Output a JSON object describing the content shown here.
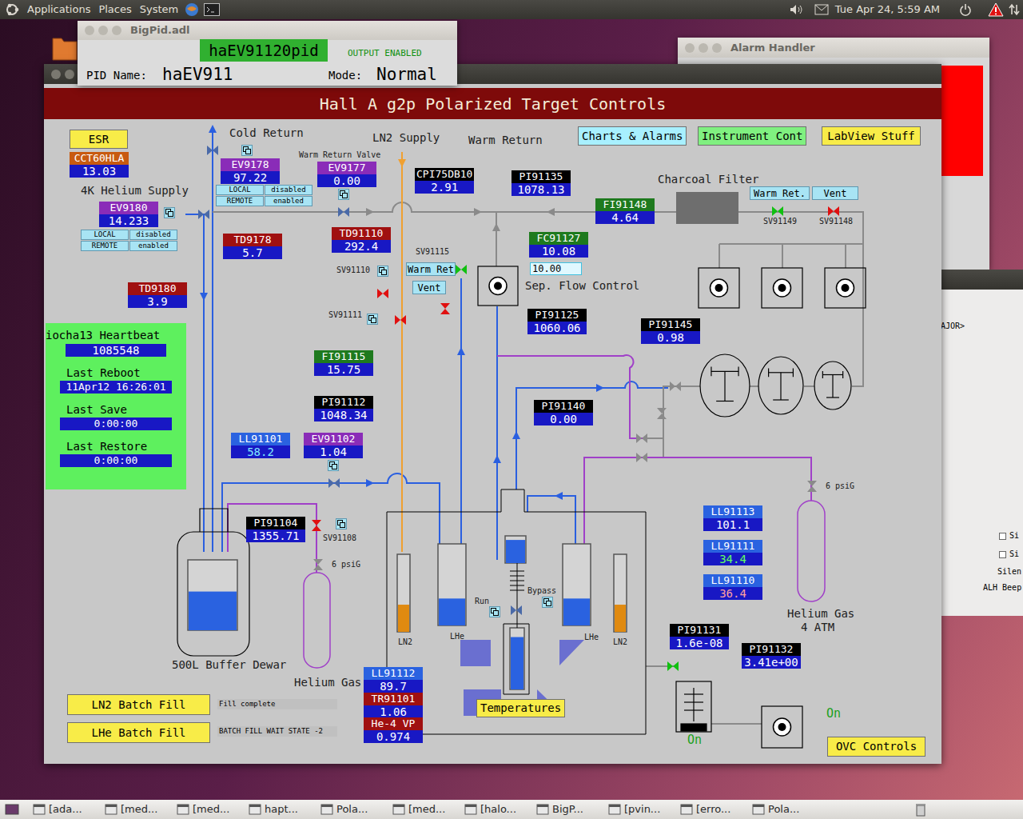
{
  "top_panel": {
    "menus": [
      "Applications",
      "Places",
      "System"
    ],
    "clock": "Tue Apr 24, 5:59 AM"
  },
  "bigpid": {
    "title": "BigPid.adl",
    "record": "haEV91120pid",
    "output": "OUTPUT ENABLED",
    "pid_name_label": "PID Name:",
    "pid_name": "haEV911",
    "mode_label": "Mode:",
    "mode": "Normal"
  },
  "alarm_handler": {
    "title": "Alarm Handler",
    "alarm_color": "#ff0000"
  },
  "side_window": {
    "prompt": "AJOR>",
    "checkboxes": [
      {
        "label": "Si",
        "checked": false
      },
      {
        "label": "Si",
        "checked": false
      }
    ],
    "labels": [
      "Silen",
      "ALH Beep"
    ]
  },
  "main": {
    "header": "Hall A g2p Polarized Target Controls",
    "buttons": [
      {
        "label": "ESR",
        "color": "#f8ec48"
      },
      {
        "label": "Charts & Alarms",
        "color": "#a8f0ff"
      },
      {
        "label": "Instrument Cont",
        "color": "#80f080"
      },
      {
        "label": "LabView Stuff",
        "color": "#f8ec48"
      },
      {
        "label": "LN2 Batch Fill",
        "color": "#f8ec48"
      },
      {
        "label": "LHe Batch Fill",
        "color": "#f8ec48"
      },
      {
        "label": "Temperatures",
        "color": "#f8ec48"
      },
      {
        "label": "OVC Controls",
        "color": "#f8ec48"
      }
    ],
    "small_buttons": [
      {
        "label": "LOCAL"
      },
      {
        "label": "disabled"
      },
      {
        "label": "REMOTE"
      },
      {
        "label": "enabled"
      },
      {
        "label": "LOCAL"
      },
      {
        "label": "disabled"
      },
      {
        "label": "REMOTE"
      },
      {
        "label": "enabled"
      },
      {
        "label": "Warm Ret"
      },
      {
        "label": "Vent"
      },
      {
        "label": "Warm Ret."
      },
      {
        "label": "Vent"
      }
    ],
    "batch_status": [
      "Fill complete",
      "BATCH FILL WAIT STATE -2"
    ],
    "setpoint": "10.00",
    "readouts": [
      {
        "label": "CCT60HLA",
        "value": "13.03",
        "color": "#c85a10",
        "valueColor": "#ffffff"
      },
      {
        "label": "EV9178",
        "value": "97.22",
        "color": "#8a2cb8",
        "valueColor": "#ffffff"
      },
      {
        "label": "EV9177",
        "value": "0.00",
        "color": "#8a2cb8",
        "valueColor": "#ffffff"
      },
      {
        "label": "EV9180",
        "value": "14.233",
        "color": "#8a2cb8",
        "valueColor": "#ffffff"
      },
      {
        "label": "TD9178",
        "value": "5.7",
        "color": "#a01010",
        "valueColor": "#ffffff"
      },
      {
        "label": "TD91110",
        "value": "292.4",
        "color": "#a01010",
        "valueColor": "#ffffff"
      },
      {
        "label": "CPI75DB10",
        "value": "2.91",
        "color": "#000000",
        "valueColor": "#ffffff"
      },
      {
        "label": "PI91135",
        "value": "1078.13",
        "color": "#000000",
        "valueColor": "#ffffff"
      },
      {
        "label": "FI91148",
        "value": "4.64",
        "color": "#1e7a1e",
        "valueColor": "#ffffff"
      },
      {
        "label": "FC91127",
        "value": "10.08",
        "color": "#1e7a1e",
        "valueColor": "#ffffff"
      },
      {
        "label": "PI91125",
        "value": "1060.06",
        "color": "#000000",
        "valueColor": "#ffffff"
      },
      {
        "label": "PI91145",
        "value": "0.98",
        "color": "#000000",
        "valueColor": "#ffffff"
      },
      {
        "label": "TD9180",
        "value": "3.9",
        "color": "#a01010",
        "valueColor": "#ffffff"
      },
      {
        "label": "FI91115",
        "value": "15.75",
        "color": "#1e7a1e",
        "valueColor": "#ffffff"
      },
      {
        "label": "PI91112",
        "value": "1048.34",
        "color": "#000000",
        "valueColor": "#ffffff"
      },
      {
        "label": "PI91140",
        "value": "0.00",
        "color": "#000000",
        "valueColor": "#ffffff"
      },
      {
        "label": "LL91101",
        "value": "58.2",
        "color": "#2a62e0",
        "valueColor": "#80e8ff"
      },
      {
        "label": "EV91102",
        "value": "1.04",
        "color": "#8a2cb8",
        "valueColor": "#ffffff"
      },
      {
        "label": "PI91104",
        "value": "1355.71",
        "color": "#000000",
        "valueColor": "#ffffff"
      },
      {
        "label": "LL91113",
        "value": "101.1",
        "color": "#2a62e0",
        "valueColor": "#ffffff"
      },
      {
        "label": "LL91111",
        "value": "34.4",
        "color": "#2a62e0",
        "valueColor": "#60ff60"
      },
      {
        "label": "LL91110",
        "value": "36.4",
        "color": "#2a62e0",
        "valueColor": "#ffa0a0"
      },
      {
        "label": "PI91131",
        "value": "1.6e-08",
        "color": "#000000",
        "valueColor": "#ffffff"
      },
      {
        "label": "PI91132",
        "value": "3.41e+00",
        "color": "#000000",
        "valueColor": "#ffffff"
      },
      {
        "label": "LL91112",
        "value": "89.7",
        "color": "#2a62e0",
        "valueColor": "#ffffff"
      },
      {
        "label": "TR91101",
        "value": "1.06",
        "color": "#a01010",
        "valueColor": "#ffffff"
      },
      {
        "label": "He-4 VP",
        "value": "0.974",
        "color": "#a01010",
        "valueColor": "#ffffff"
      }
    ],
    "labels": [
      {
        "text": "Cold Return",
        "kind": "title"
      },
      {
        "text": "LN2 Supply",
        "kind": "title"
      },
      {
        "text": "Warm Return",
        "kind": "title"
      },
      {
        "text": "Charcoal Filter",
        "kind": "title"
      },
      {
        "text": "4K Helium Supply",
        "kind": "title"
      },
      {
        "text": "Warm Return Valve",
        "kind": "small"
      },
      {
        "text": "Sep. Flow Control",
        "kind": "title"
      },
      {
        "text": "SV91115",
        "kind": "small"
      },
      {
        "text": "SV91110",
        "kind": "small"
      },
      {
        "text": "SV91111",
        "kind": "small"
      },
      {
        "text": "SV91149",
        "kind": "small"
      },
      {
        "text": "SV91148",
        "kind": "small"
      },
      {
        "text": "SV91108",
        "kind": "small"
      },
      {
        "text": "6 psiG",
        "kind": "small"
      },
      {
        "text": "6 psiG",
        "kind": "small"
      },
      {
        "text": "500L Buffer Dewar",
        "kind": "title"
      },
      {
        "text": "Helium Gas",
        "kind": "title"
      },
      {
        "text": "Helium Gas",
        "kind": "title"
      },
      {
        "text": "4 ATM",
        "kind": "title"
      },
      {
        "text": "LN2",
        "kind": "small"
      },
      {
        "text": "LHe",
        "kind": "small"
      },
      {
        "text": "LHe",
        "kind": "small"
      },
      {
        "text": "LN2",
        "kind": "small"
      },
      {
        "text": "Run",
        "kind": "small"
      },
      {
        "text": "Bypass",
        "kind": "small"
      },
      {
        "text": "On",
        "kind": "status"
      },
      {
        "text": "On",
        "kind": "status"
      }
    ],
    "valves": [
      {
        "color": "#10c010"
      },
      {
        "color": "#e01010"
      },
      {
        "color": "#10c010"
      },
      {
        "color": "#e01010"
      },
      {
        "color": "#e01010"
      },
      {
        "color": "#e01010"
      },
      {
        "color": "#e01010"
      },
      {
        "color": "#10c010"
      }
    ],
    "tanks": [
      {
        "level": 0.55,
        "color": "#2a62e0"
      },
      {
        "level": 0.35,
        "color": "#e08a10"
      },
      {
        "level": 0.33,
        "color": "#2a62e0"
      },
      {
        "level": 0.85,
        "color": "#2a62e0"
      },
      {
        "level": 0.85,
        "color": "#2a62e0"
      },
      {
        "level": 0.33,
        "color": "#2a62e0"
      },
      {
        "level": 0.35,
        "color": "#e08a10"
      }
    ],
    "heartbeat": {
      "title": "iocha13 Heartbeat",
      "count": "1085548",
      "fields": [
        {
          "label": "Last Reboot",
          "value": "11Apr12 16:26:01"
        },
        {
          "label": "Last Save",
          "value": "0:00:00"
        },
        {
          "label": "Last Restore",
          "value": "0:00:00"
        }
      ]
    }
  },
  "taskbar": {
    "items": [
      "[ada...",
      "[med...",
      "[med...",
      "hapt...",
      "Pola...",
      "[med...",
      "[halo...",
      "BigP...",
      "[pvin...",
      "[erro...",
      "Pola..."
    ]
  }
}
